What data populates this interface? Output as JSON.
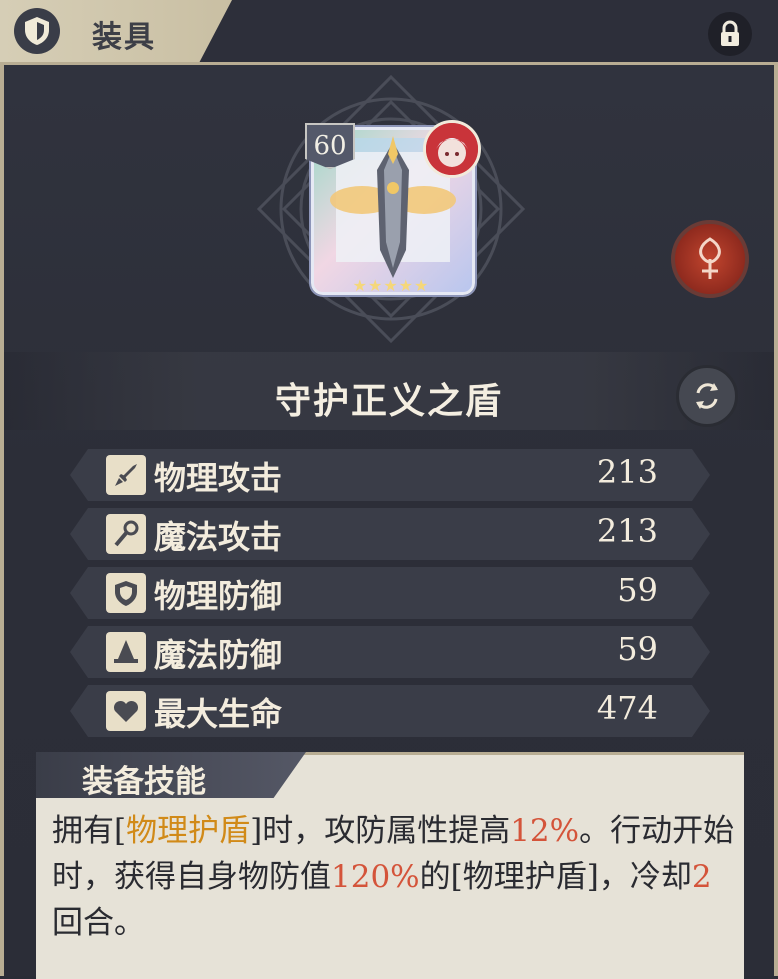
{
  "header": {
    "title": "装具",
    "icon": "shield-icon",
    "lock_icon": "lock-icon"
  },
  "item": {
    "level": "60",
    "stars": "★★★★★",
    "name": "守护正义之盾",
    "swap_icon": "swap-icon",
    "rune_icon": "rune-icon"
  },
  "stats": [
    {
      "label": "物理攻击",
      "value": "213",
      "icon": "sword-icon"
    },
    {
      "label": "魔法攻击",
      "value": "213",
      "icon": "staff-icon"
    },
    {
      "label": "物理防御",
      "value": "59",
      "icon": "shield-icon"
    },
    {
      "label": "魔法防御",
      "value": "59",
      "icon": "wizard-hat-icon"
    },
    {
      "label": "最大生命",
      "value": "474",
      "icon": "heart-icon"
    }
  ],
  "skill": {
    "title": "装备技能",
    "p1": "拥有[",
    "h1": "物理护盾",
    "p2": "]时，攻防属性提高",
    "h2": "12%",
    "p3": "。行动开始时，获得自身物防值",
    "h3": "120%",
    "p4": "的[物理护盾]，冷却",
    "h4": "2",
    "p5": "回合。"
  },
  "colors": {
    "highlight_gold": "#d18a18",
    "highlight_red": "#d4543a"
  }
}
